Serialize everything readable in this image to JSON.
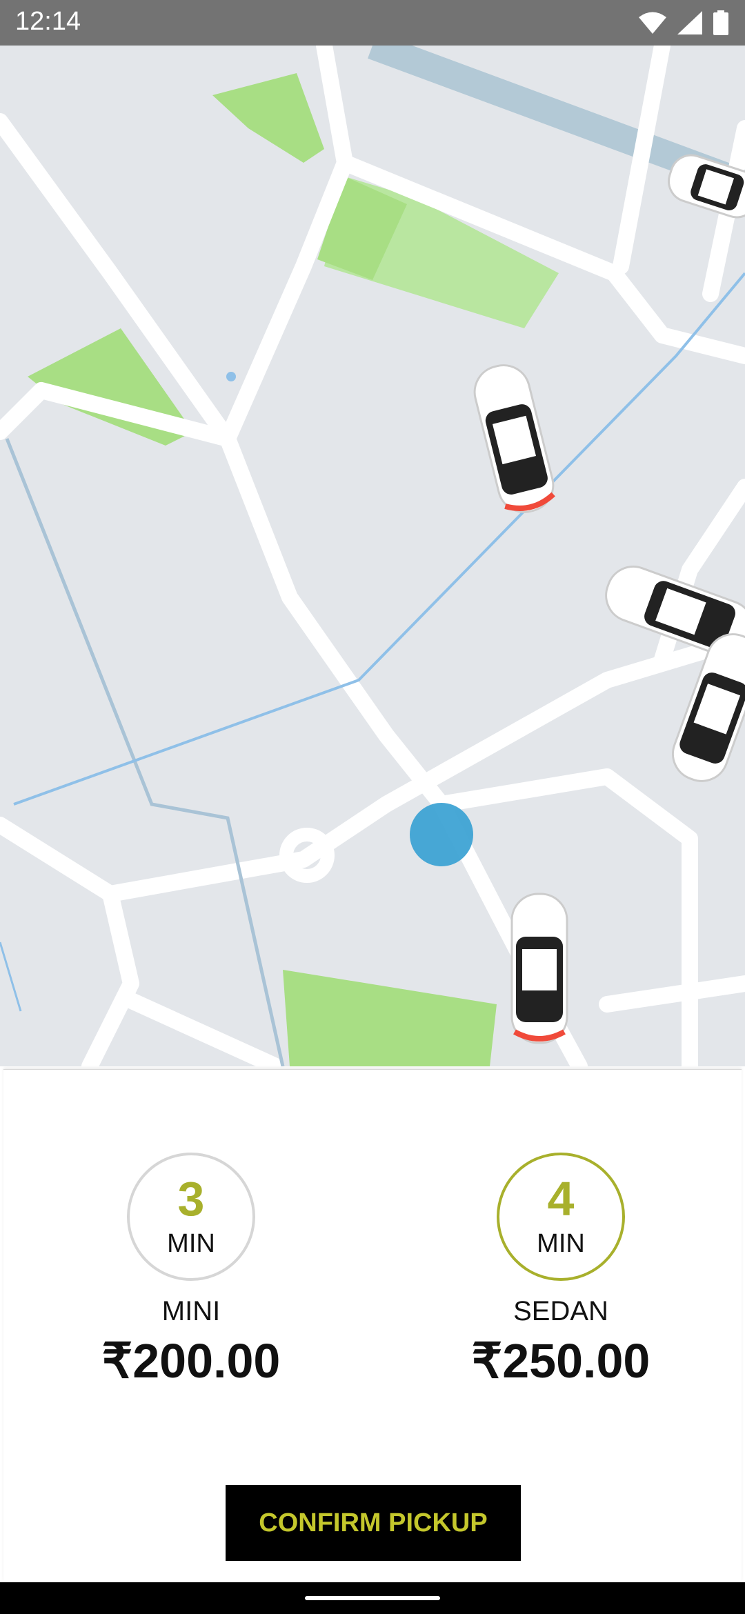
{
  "status_bar": {
    "time": "12:14",
    "icons": [
      "wifi-icon",
      "signal-icon",
      "battery-icon"
    ]
  },
  "map": {
    "markers": [
      "car-marker",
      "car-marker",
      "car-marker",
      "car-marker",
      "car-marker"
    ],
    "location_dot_color": "#3ea3d4"
  },
  "ride_options": [
    {
      "eta_value": "3",
      "eta_unit": "MIN",
      "name": "MINI",
      "price": "₹200.00",
      "selected": false
    },
    {
      "eta_value": "4",
      "eta_unit": "MIN",
      "name": "SEDAN",
      "price": "₹250.00",
      "selected": true
    }
  ],
  "confirm_button": {
    "label": "CONFIRM PICKUP"
  },
  "colors": {
    "accent": "#a8b02c",
    "button_bg": "#000000",
    "button_text": "#c4c72c",
    "map_bg": "#e3e6ea",
    "park": "#a8de84"
  }
}
